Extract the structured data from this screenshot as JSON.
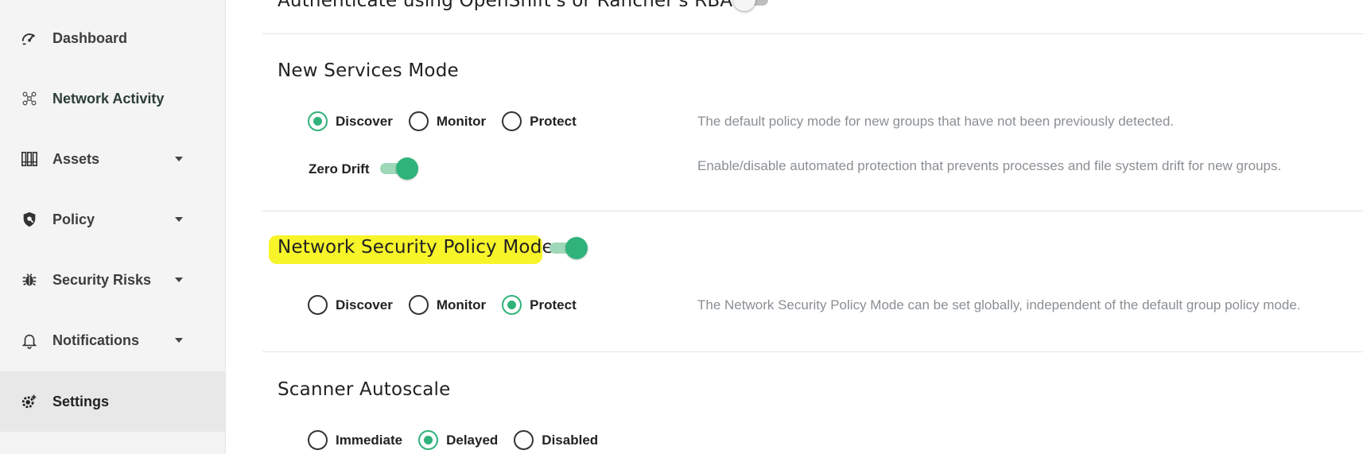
{
  "sidebar": {
    "items": [
      {
        "label": "Dashboard",
        "icon": "speedometer-icon",
        "has_caret": false
      },
      {
        "label": "Network Activity",
        "icon": "network-icon",
        "has_caret": false
      },
      {
        "label": "Assets",
        "icon": "assets-icon",
        "has_caret": true
      },
      {
        "label": "Policy",
        "icon": "shield-icon",
        "has_caret": true
      },
      {
        "label": "Security Risks",
        "icon": "bug-icon",
        "has_caret": true
      },
      {
        "label": "Notifications",
        "icon": "bell-icon",
        "has_caret": true
      },
      {
        "label": "Settings",
        "icon": "gear-icon",
        "has_caret": false,
        "active": true
      }
    ]
  },
  "main": {
    "rbac": {
      "title": "Authenticate using OpenShift's or Rancher's RBAC",
      "enabled": false
    },
    "new_services": {
      "title": "New Services Mode",
      "options": [
        "Discover",
        "Monitor",
        "Protect"
      ],
      "selected": "Discover",
      "hint": "The default policy mode for new groups that have not been previously detected.",
      "zero_drift": {
        "label": "Zero Drift",
        "enabled": true,
        "hint": "Enable/disable automated protection that prevents processes and file system drift for new groups."
      }
    },
    "network_security": {
      "title": "Network Security Policy Mode",
      "enabled": true,
      "options": [
        "Discover",
        "Monitor",
        "Protect"
      ],
      "selected": "Protect",
      "hint": "The Network Security Policy Mode can be set globally, independent of the default group policy mode."
    },
    "scanner": {
      "title": "Scanner Autoscale",
      "options": [
        "Immediate",
        "Delayed",
        "Disabled"
      ],
      "selected": "Delayed"
    }
  },
  "colors": {
    "accent": "#2fb37a",
    "highlight": "#f7f42a",
    "hint_text": "#8a8f94",
    "sidebar_bg": "#f4f4f4"
  }
}
